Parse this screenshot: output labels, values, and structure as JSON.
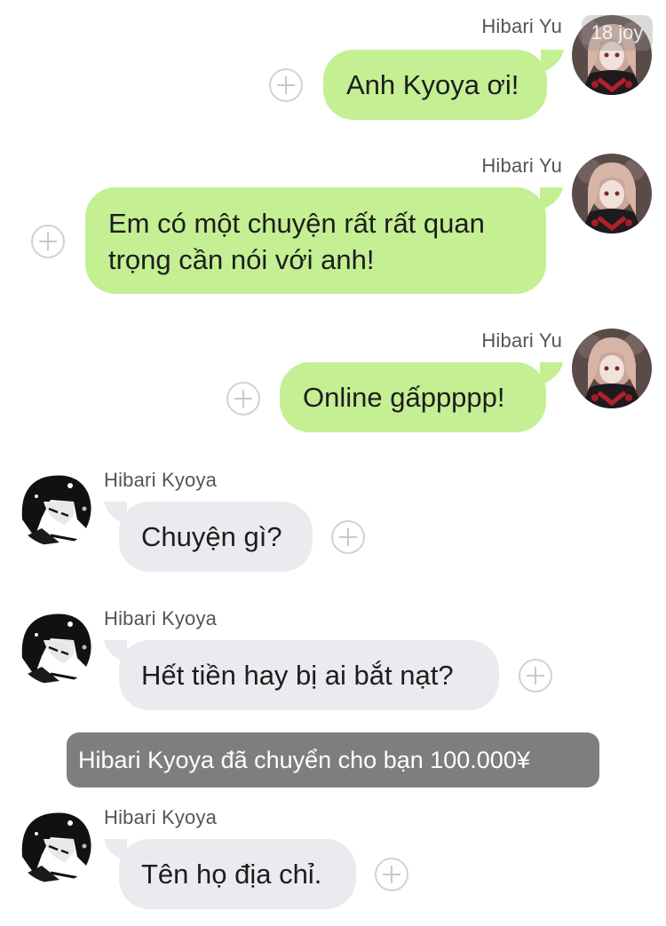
{
  "users": {
    "me": "Hibari Yu",
    "other": "Hibari Kyoya"
  },
  "messages": [
    {
      "sender": "Hibari Yu",
      "text": "Anh Kyoya ơi!"
    },
    {
      "sender": "Hibari Yu",
      "text_line1": "Em có một chuyện rất rất quan",
      "text_line2": "trọng cần nói với anh!"
    },
    {
      "sender": "Hibari Yu",
      "text": "Online gấppppp!"
    },
    {
      "sender": "Hibari Kyoya",
      "text": "Chuyện gì?"
    },
    {
      "sender": "Hibari Kyoya",
      "text": "Hết tiền hay bị ai bắt nạt?"
    },
    {
      "sender": "Hibari Kyoya",
      "text": "Tên họ địa chỉ."
    }
  ],
  "system_notice": "Hibari Kyoya đã chuyển cho bạn 100.000¥",
  "watermark": "18 joy",
  "colors": {
    "outgoing_bubble": "#c4ef93",
    "incoming_bubble": "#e9ebee",
    "system_notice_bg": "#7e7e7e"
  },
  "icons": {
    "add": "plus-circle-icon",
    "avatar_me": "anime-girl-avatar",
    "avatar_other": "anime-boy-avatar"
  }
}
